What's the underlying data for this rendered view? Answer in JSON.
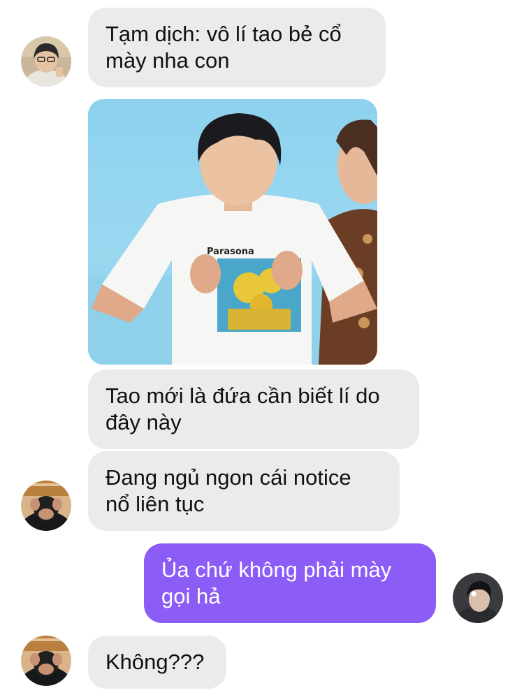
{
  "conversation": {
    "messages": [
      {
        "sender": "friend-1",
        "direction": "incoming",
        "text_lines": [
          "Tạm dịch: vô lí tao bẻ cổ",
          "mày nha con"
        ]
      },
      {
        "sender": "friend-1",
        "direction": "incoming",
        "type": "image",
        "shirt_text": "Parasona"
      },
      {
        "sender": "friend-2",
        "direction": "incoming",
        "text_lines": [
          "Tao mới là đứa cần biết lí do",
          "đây này"
        ]
      },
      {
        "sender": "friend-2",
        "direction": "incoming",
        "text_lines": [
          "Đang ngủ ngon cái notice",
          "nổ liên tục"
        ]
      },
      {
        "sender": "me",
        "direction": "outgoing",
        "text_lines": [
          "Ủa chứ không phải mày",
          "gọi hả"
        ]
      },
      {
        "sender": "friend-2",
        "direction": "incoming",
        "text_lines": [
          "Không???"
        ]
      }
    ]
  },
  "colors": {
    "incoming_bubble": "#ebebed",
    "outgoing_bubble": "#8b5cf6",
    "page_background": "#ffffff"
  }
}
